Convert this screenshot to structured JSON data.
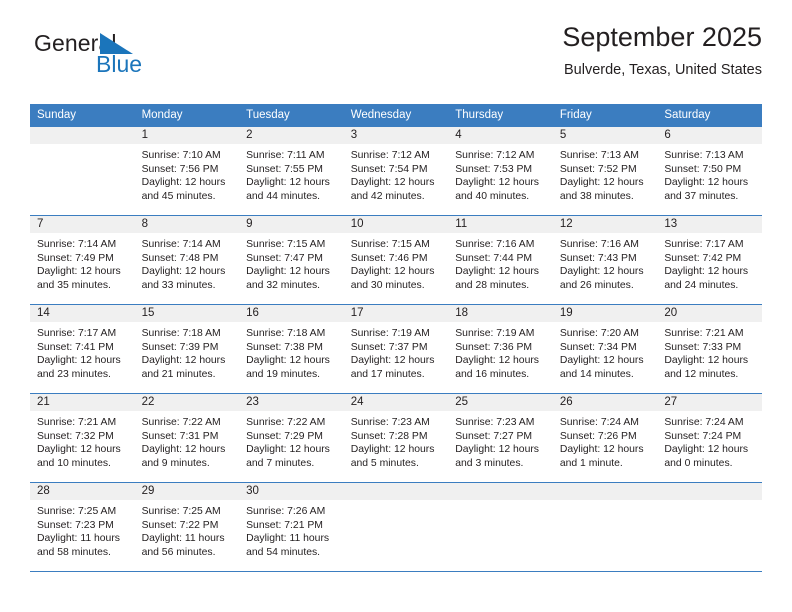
{
  "logo": {
    "text_primary": "General",
    "text_secondary": "Blue",
    "triangle_icon": "logo-triangle-icon",
    "color_primary": "#231f20",
    "color_secondary": "#1b75bb"
  },
  "header": {
    "title": "September 2025",
    "location": "Bulverde, Texas, United States"
  },
  "theme": {
    "header_blue": "#3b7dc0",
    "daynum_band": "#f0f0f0",
    "text": "#231f20"
  },
  "weekday_headers": [
    "Sunday",
    "Monday",
    "Tuesday",
    "Wednesday",
    "Thursday",
    "Friday",
    "Saturday"
  ],
  "weeks": [
    [
      {
        "day": "",
        "sunrise": "",
        "sunset": "",
        "daylight_line1": "",
        "daylight_line2": "",
        "empty": true
      },
      {
        "day": "1",
        "sunrise": "Sunrise: 7:10 AM",
        "sunset": "Sunset: 7:56 PM",
        "daylight_line1": "Daylight: 12 hours",
        "daylight_line2": "and 45 minutes."
      },
      {
        "day": "2",
        "sunrise": "Sunrise: 7:11 AM",
        "sunset": "Sunset: 7:55 PM",
        "daylight_line1": "Daylight: 12 hours",
        "daylight_line2": "and 44 minutes."
      },
      {
        "day": "3",
        "sunrise": "Sunrise: 7:12 AM",
        "sunset": "Sunset: 7:54 PM",
        "daylight_line1": "Daylight: 12 hours",
        "daylight_line2": "and 42 minutes."
      },
      {
        "day": "4",
        "sunrise": "Sunrise: 7:12 AM",
        "sunset": "Sunset: 7:53 PM",
        "daylight_line1": "Daylight: 12 hours",
        "daylight_line2": "and 40 minutes."
      },
      {
        "day": "5",
        "sunrise": "Sunrise: 7:13 AM",
        "sunset": "Sunset: 7:52 PM",
        "daylight_line1": "Daylight: 12 hours",
        "daylight_line2": "and 38 minutes."
      },
      {
        "day": "6",
        "sunrise": "Sunrise: 7:13 AM",
        "sunset": "Sunset: 7:50 PM",
        "daylight_line1": "Daylight: 12 hours",
        "daylight_line2": "and 37 minutes."
      }
    ],
    [
      {
        "day": "7",
        "sunrise": "Sunrise: 7:14 AM",
        "sunset": "Sunset: 7:49 PM",
        "daylight_line1": "Daylight: 12 hours",
        "daylight_line2": "and 35 minutes."
      },
      {
        "day": "8",
        "sunrise": "Sunrise: 7:14 AM",
        "sunset": "Sunset: 7:48 PM",
        "daylight_line1": "Daylight: 12 hours",
        "daylight_line2": "and 33 minutes."
      },
      {
        "day": "9",
        "sunrise": "Sunrise: 7:15 AM",
        "sunset": "Sunset: 7:47 PM",
        "daylight_line1": "Daylight: 12 hours",
        "daylight_line2": "and 32 minutes."
      },
      {
        "day": "10",
        "sunrise": "Sunrise: 7:15 AM",
        "sunset": "Sunset: 7:46 PM",
        "daylight_line1": "Daylight: 12 hours",
        "daylight_line2": "and 30 minutes."
      },
      {
        "day": "11",
        "sunrise": "Sunrise: 7:16 AM",
        "sunset": "Sunset: 7:44 PM",
        "daylight_line1": "Daylight: 12 hours",
        "daylight_line2": "and 28 minutes."
      },
      {
        "day": "12",
        "sunrise": "Sunrise: 7:16 AM",
        "sunset": "Sunset: 7:43 PM",
        "daylight_line1": "Daylight: 12 hours",
        "daylight_line2": "and 26 minutes."
      },
      {
        "day": "13",
        "sunrise": "Sunrise: 7:17 AM",
        "sunset": "Sunset: 7:42 PM",
        "daylight_line1": "Daylight: 12 hours",
        "daylight_line2": "and 24 minutes."
      }
    ],
    [
      {
        "day": "14",
        "sunrise": "Sunrise: 7:17 AM",
        "sunset": "Sunset: 7:41 PM",
        "daylight_line1": "Daylight: 12 hours",
        "daylight_line2": "and 23 minutes."
      },
      {
        "day": "15",
        "sunrise": "Sunrise: 7:18 AM",
        "sunset": "Sunset: 7:39 PM",
        "daylight_line1": "Daylight: 12 hours",
        "daylight_line2": "and 21 minutes."
      },
      {
        "day": "16",
        "sunrise": "Sunrise: 7:18 AM",
        "sunset": "Sunset: 7:38 PM",
        "daylight_line1": "Daylight: 12 hours",
        "daylight_line2": "and 19 minutes."
      },
      {
        "day": "17",
        "sunrise": "Sunrise: 7:19 AM",
        "sunset": "Sunset: 7:37 PM",
        "daylight_line1": "Daylight: 12 hours",
        "daylight_line2": "and 17 minutes."
      },
      {
        "day": "18",
        "sunrise": "Sunrise: 7:19 AM",
        "sunset": "Sunset: 7:36 PM",
        "daylight_line1": "Daylight: 12 hours",
        "daylight_line2": "and 16 minutes."
      },
      {
        "day": "19",
        "sunrise": "Sunrise: 7:20 AM",
        "sunset": "Sunset: 7:34 PM",
        "daylight_line1": "Daylight: 12 hours",
        "daylight_line2": "and 14 minutes."
      },
      {
        "day": "20",
        "sunrise": "Sunrise: 7:21 AM",
        "sunset": "Sunset: 7:33 PM",
        "daylight_line1": "Daylight: 12 hours",
        "daylight_line2": "and 12 minutes."
      }
    ],
    [
      {
        "day": "21",
        "sunrise": "Sunrise: 7:21 AM",
        "sunset": "Sunset: 7:32 PM",
        "daylight_line1": "Daylight: 12 hours",
        "daylight_line2": "and 10 minutes."
      },
      {
        "day": "22",
        "sunrise": "Sunrise: 7:22 AM",
        "sunset": "Sunset: 7:31 PM",
        "daylight_line1": "Daylight: 12 hours",
        "daylight_line2": "and 9 minutes."
      },
      {
        "day": "23",
        "sunrise": "Sunrise: 7:22 AM",
        "sunset": "Sunset: 7:29 PM",
        "daylight_line1": "Daylight: 12 hours",
        "daylight_line2": "and 7 minutes."
      },
      {
        "day": "24",
        "sunrise": "Sunrise: 7:23 AM",
        "sunset": "Sunset: 7:28 PM",
        "daylight_line1": "Daylight: 12 hours",
        "daylight_line2": "and 5 minutes."
      },
      {
        "day": "25",
        "sunrise": "Sunrise: 7:23 AM",
        "sunset": "Sunset: 7:27 PM",
        "daylight_line1": "Daylight: 12 hours",
        "daylight_line2": "and 3 minutes."
      },
      {
        "day": "26",
        "sunrise": "Sunrise: 7:24 AM",
        "sunset": "Sunset: 7:26 PM",
        "daylight_line1": "Daylight: 12 hours",
        "daylight_line2": "and 1 minute."
      },
      {
        "day": "27",
        "sunrise": "Sunrise: 7:24 AM",
        "sunset": "Sunset: 7:24 PM",
        "daylight_line1": "Daylight: 12 hours",
        "daylight_line2": "and 0 minutes."
      }
    ],
    [
      {
        "day": "28",
        "sunrise": "Sunrise: 7:25 AM",
        "sunset": "Sunset: 7:23 PM",
        "daylight_line1": "Daylight: 11 hours",
        "daylight_line2": "and 58 minutes."
      },
      {
        "day": "29",
        "sunrise": "Sunrise: 7:25 AM",
        "sunset": "Sunset: 7:22 PM",
        "daylight_line1": "Daylight: 11 hours",
        "daylight_line2": "and 56 minutes."
      },
      {
        "day": "30",
        "sunrise": "Sunrise: 7:26 AM",
        "sunset": "Sunset: 7:21 PM",
        "daylight_line1": "Daylight: 11 hours",
        "daylight_line2": "and 54 minutes."
      },
      {
        "day": "",
        "sunrise": "",
        "sunset": "",
        "daylight_line1": "",
        "daylight_line2": "",
        "empty": true
      },
      {
        "day": "",
        "sunrise": "",
        "sunset": "",
        "daylight_line1": "",
        "daylight_line2": "",
        "empty": true
      },
      {
        "day": "",
        "sunrise": "",
        "sunset": "",
        "daylight_line1": "",
        "daylight_line2": "",
        "empty": true
      },
      {
        "day": "",
        "sunrise": "",
        "sunset": "",
        "daylight_line1": "",
        "daylight_line2": "",
        "empty": true
      }
    ]
  ]
}
